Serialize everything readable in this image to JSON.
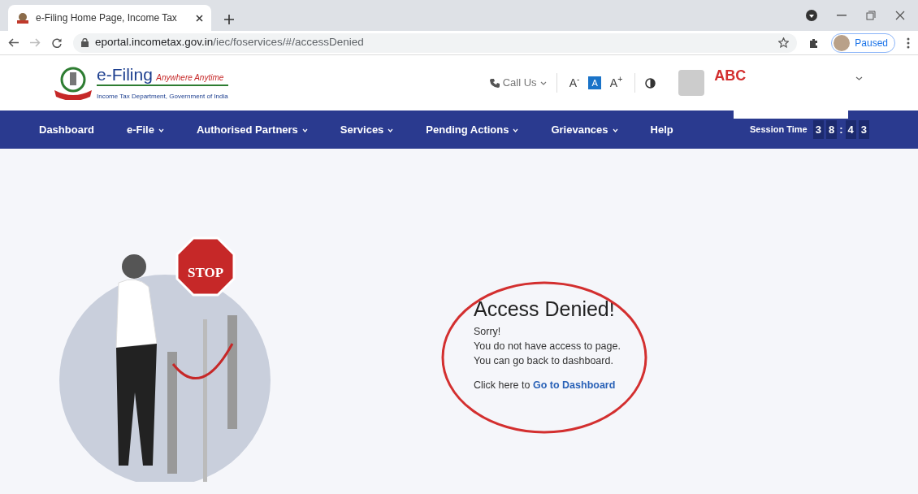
{
  "browser": {
    "tab_title": "e-Filing Home Page, Income Tax",
    "address": {
      "host": "eportal.incometax.gov.in",
      "path": "/iec/foservices/#/accessDenied"
    },
    "profile_status": "Paused"
  },
  "header": {
    "logo_title": "e-Filing",
    "logo_tagline": "Anywhere Anytime",
    "logo_subtitle": "Income Tax Department, Government of India",
    "call_us": "Call Us",
    "font_sizes": [
      {
        "label": "A$^{-}$",
        "selected": false
      },
      {
        "label": "A",
        "selected": true
      },
      {
        "label": "A$^{+}$",
        "selected": false
      }
    ],
    "user_name": "ABC"
  },
  "nav": [
    {
      "label": "Dashboard",
      "dropdown": false
    },
    {
      "label": "e-File",
      "dropdown": true
    },
    {
      "label": "Authorised Partners",
      "dropdown": true
    },
    {
      "label": "Services",
      "dropdown": true
    },
    {
      "label": "Pending Actions",
      "dropdown": true
    },
    {
      "label": "Grievances",
      "dropdown": true
    },
    {
      "label": "Help",
      "dropdown": false
    }
  ],
  "session": {
    "label": "Session Time",
    "chars": [
      {
        "kind": "digit",
        "text": "3"
      },
      {
        "kind": "digit",
        "text": "8"
      },
      {
        "kind": "separator",
        "text": ":"
      },
      {
        "kind": "digit",
        "text": "4"
      },
      {
        "kind": "digit",
        "text": "3"
      }
    ]
  },
  "illustration": {
    "sign_text": "STOP"
  },
  "message": {
    "title": "Access Denied!",
    "lines": [
      "Sorry!",
      "You do not have access to page.",
      "You can go back to dashboard."
    ],
    "prompt": "Click here to",
    "link": "Go to Dashboard"
  }
}
